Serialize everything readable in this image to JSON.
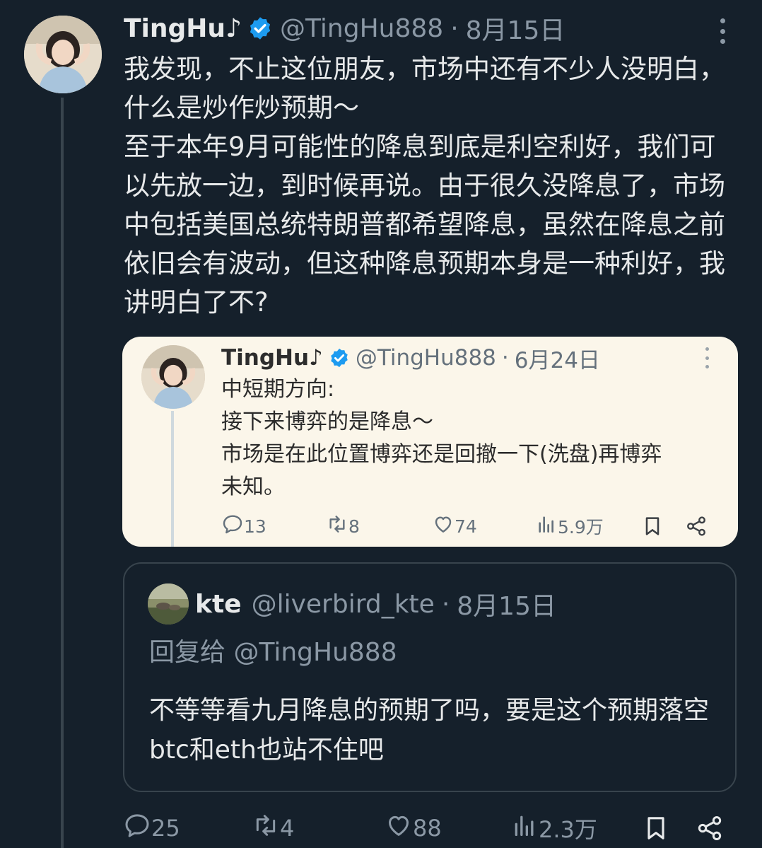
{
  "tweet": {
    "author_name": "TingHu♪",
    "handle": "@TingHu888",
    "separator": "·",
    "date": "8月15日",
    "text": "我发现，不止这位朋友，市场中还有不少人没明白，什么是炒作炒预期～\n至于本年9月可能性的降息到底是利空利好，我们可以先放一边，到时候再说。由于很久没降息了，市场中包括美国总统特朗普都希望降息，虽然在降息之前依旧会有波动，但这种降息预期本身是一种利好，我讲明白了不?",
    "actions": {
      "replies": "25",
      "retweets": "4",
      "likes": "88",
      "views": "2.3万"
    }
  },
  "quoted_tweet": {
    "author_name": "TingHu♪",
    "handle": "@TingHu888",
    "separator": "·",
    "date": "6月24日",
    "text": "中短期方向:\n接下来博弈的是降息～\n市场是在此位置博弈还是回撤一下(洗盘)再博弈\n未知。",
    "actions": {
      "replies": "13",
      "retweets": "8",
      "likes": "74",
      "views": "5.9万"
    }
  },
  "reply_tweet": {
    "author_name": "kte",
    "handle": "@liverbird_kte",
    "separator": "·",
    "date": "8月15日",
    "replying_to": "回复给 @TingHu888",
    "text": "不等等看九月降息的预期了吗，要是这个预期落空btc和eth也站不住吧"
  },
  "colors": {
    "background": "#15202b",
    "text": "#e7e9ea",
    "muted": "#8b98a5",
    "verified": "#1d9bf0",
    "quote_background": "#fbf6ea"
  },
  "icons": [
    "verified-badge-icon",
    "more-icon",
    "reply-icon",
    "retweet-icon",
    "like-icon",
    "views-icon",
    "bookmark-icon",
    "share-icon"
  ]
}
